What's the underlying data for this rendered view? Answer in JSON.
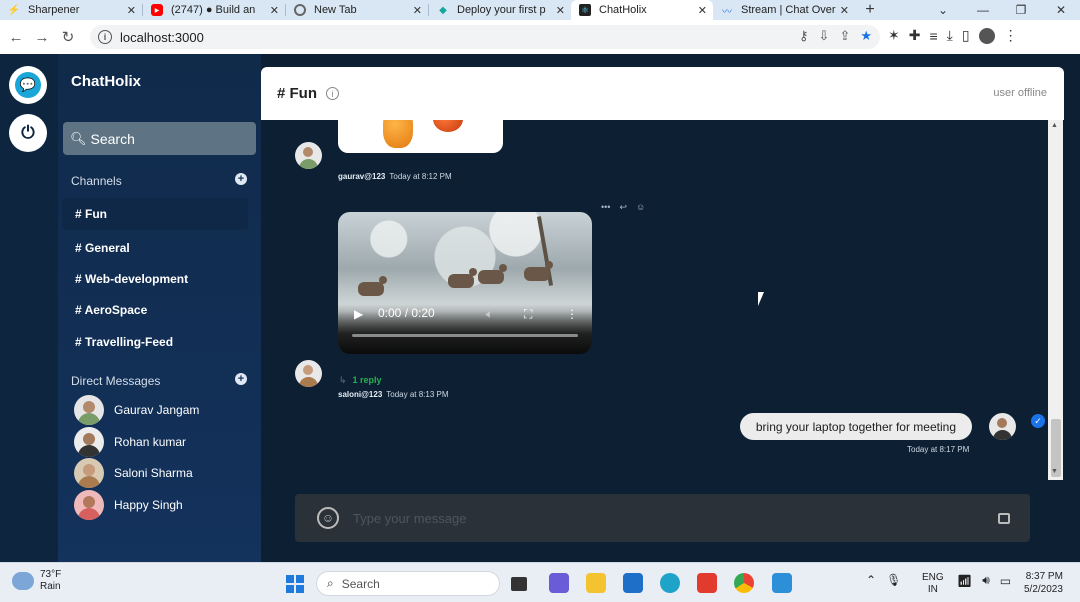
{
  "browser": {
    "tabs": [
      {
        "label": "Sharpener",
        "icon": "sharpener-favicon-icon",
        "active": false
      },
      {
        "label": "(2747) ● Build an",
        "icon": "youtube-favicon-icon",
        "active": false
      },
      {
        "label": "New Tab",
        "icon": "chrome-favicon-icon",
        "active": false
      },
      {
        "label": "Deploy your first p",
        "icon": "netlify-favicon-icon",
        "active": false
      },
      {
        "label": "ChatHolix",
        "icon": "react-favicon-icon",
        "active": true
      },
      {
        "label": "Stream | Chat Over",
        "icon": "stream-favicon-icon",
        "active": false
      }
    ],
    "url": "localhost:3000"
  },
  "sidebar": {
    "brand": "ChatHolix",
    "search_label": "Search",
    "channels_label": "Channels",
    "channels": [
      "# Fun",
      "# General",
      "# Web-development",
      "# AeroSpace",
      "# Travelling-Feed"
    ],
    "dm_label": "Direct Messages",
    "dms": [
      "Gaurav Jangam",
      "Rohan kumar",
      "Saloni Sharma",
      "Happy Singh"
    ]
  },
  "chat": {
    "title": "# Fun",
    "status": "user offline",
    "messages": [
      {
        "user": "gaurav@123",
        "time": "Today at 8:12 PM"
      },
      {
        "video_time": "0:00 / 0:20",
        "reply": "1 reply",
        "user": "saloni@123",
        "time": "Today at 8:13 PM"
      },
      {
        "text": "bring your laptop together for meeting",
        "time": "Today at 8:17 PM"
      }
    ],
    "composer_placeholder": "Type your message"
  },
  "taskbar": {
    "temp": "73°F",
    "weather": "Rain",
    "search": "Search",
    "lang1": "ENG",
    "lang2": "IN",
    "time": "8:37 PM",
    "date": "5/2/2023"
  },
  "colors": {
    "accent": "#1ba6d9",
    "sidebar": "#13325c",
    "chat_bg": "#0c1f33",
    "reply_green": "#26b14d"
  }
}
